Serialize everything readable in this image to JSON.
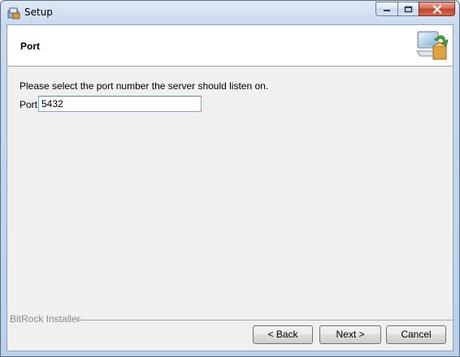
{
  "window": {
    "title": "Setup",
    "icon": "setup-app-icon"
  },
  "caption_buttons": {
    "minimize": "minimize-icon",
    "maximize": "maximize-icon",
    "close": "close-icon"
  },
  "header": {
    "title": "Port",
    "icon": "computer-install-icon"
  },
  "form": {
    "prompt": "Please select the port number the server should listen on.",
    "port_label": "Port",
    "port_value": "5432"
  },
  "footer": {
    "brand": "BitRock Installer",
    "back_label": "< Back",
    "next_label": "Next >",
    "cancel_label": "Cancel"
  },
  "colors": {
    "accent": "#5b87b7",
    "close_red": "#c2432a"
  }
}
